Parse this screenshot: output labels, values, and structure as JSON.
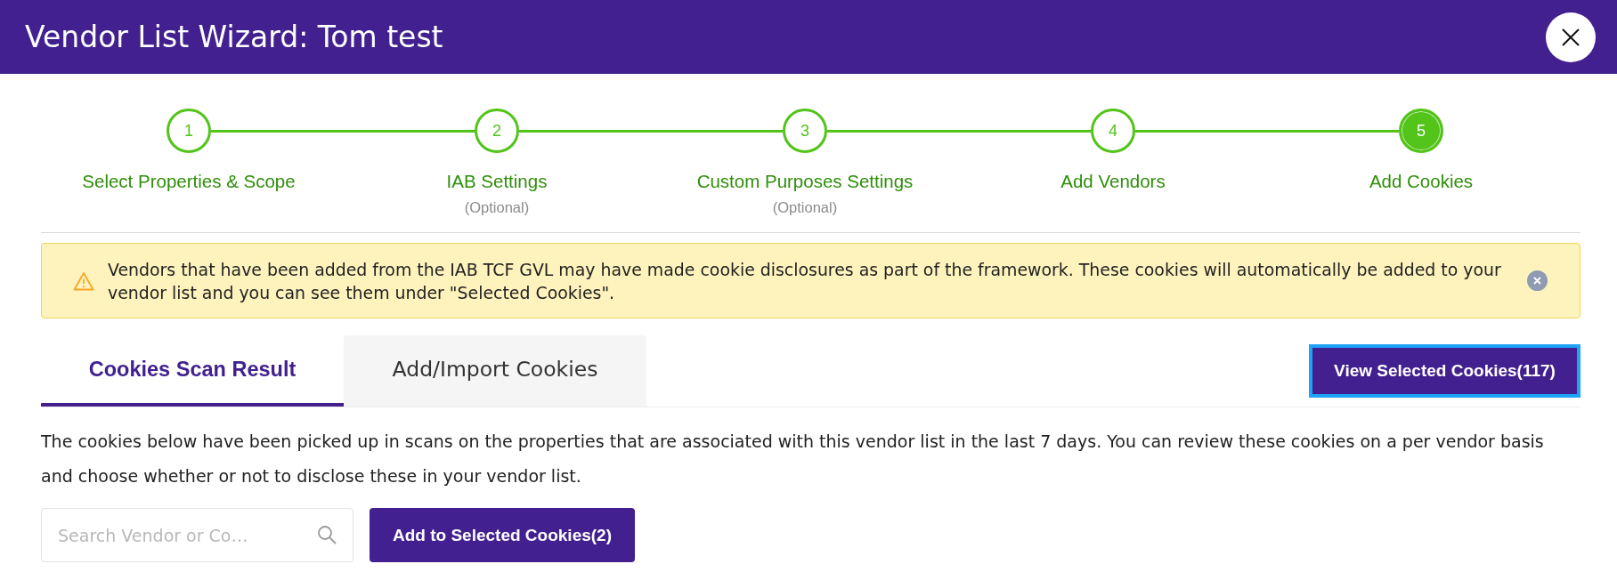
{
  "window": {
    "title": "Vendor List Wizard: Tom test"
  },
  "steps": [
    {
      "number": "1",
      "label": "Select Properties & Scope",
      "selected": false
    },
    {
      "number": "2",
      "label": "IAB Settings",
      "note": "(Optional)",
      "selected": false
    },
    {
      "number": "3",
      "label": "Custom Purposes Settings",
      "note": "(Optional)",
      "selected": false
    },
    {
      "number": "4",
      "label": "Add Vendors",
      "selected": false
    },
    {
      "number": "5",
      "label": "Add Cookies",
      "selected": true
    }
  ],
  "alert": {
    "message": "Vendors that have been added from the IAB TCF GVL may have made cookie disclosures as part of the framework. These cookies will automatically be added to your vendor list and you can see them under \"Selected Cookies\"."
  },
  "tabs": [
    {
      "label": "Cookies Scan Result",
      "selected": true
    },
    {
      "label": "Add/Import Cookies",
      "selected": false
    }
  ],
  "view_button": {
    "label": "View Selected Cookies(117)",
    "focused": true
  },
  "description": "The cookies below have been picked up in scans on the properties that are associated with this vendor list in the last 7 days. You can review these cookies on a per vendor basis and choose whether or not to disclose these in your vendor list.",
  "search": {
    "placeholder": "Search Vendor or Co…"
  },
  "add_button": {
    "label": "Add to Selected Cookies(2)"
  }
}
